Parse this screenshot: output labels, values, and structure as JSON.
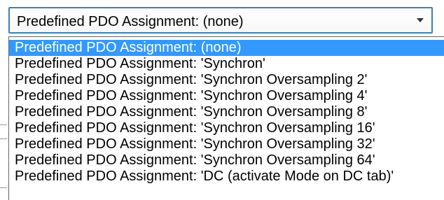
{
  "combo": {
    "value": "Predefined PDO Assignment: (none)",
    "arrow_icon": "chevron-down-icon"
  },
  "dropdown": {
    "selected_index": 0,
    "selected_color": "#3399ff",
    "options": [
      "Predefined PDO Assignment: (none)",
      "Predefined PDO Assignment: 'Synchron'",
      "Predefined PDO Assignment: 'Synchron Oversampling 2'",
      "Predefined PDO Assignment: 'Synchron Oversampling 4'",
      "Predefined PDO Assignment: 'Synchron Oversampling 8'",
      "Predefined PDO Assignment: 'Synchron Oversampling 16'",
      "Predefined PDO Assignment: 'Synchron Oversampling 32'",
      "Predefined PDO Assignment: 'Synchron Oversampling 64'",
      "Predefined PDO Assignment: 'DC (activate Mode on DC tab)'"
    ]
  }
}
